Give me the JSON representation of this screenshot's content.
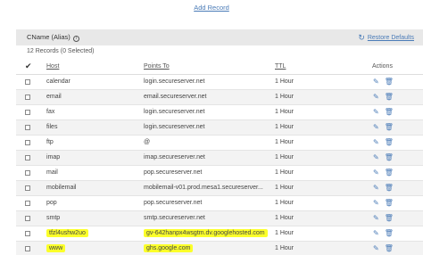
{
  "add_record_label": "Add Record",
  "section": {
    "title": "CName (Alias)",
    "info_glyph": "i",
    "restore_label": "Restore Defaults",
    "restore_glyph": "↻"
  },
  "records_count": "12 Records (0 Selected)",
  "table": {
    "columns": {
      "check": "✔",
      "host": "Host",
      "points_to": "Points To",
      "ttl": "TTL",
      "actions": "Actions"
    },
    "edit_glyph": "✎",
    "delete_glyph": "🗑",
    "rows": [
      {
        "host": "calendar",
        "points_to": "login.secureserver.net",
        "ttl": "1 Hour",
        "highlight": false
      },
      {
        "host": "email",
        "points_to": "email.secureserver.net",
        "ttl": "1 Hour",
        "highlight": false
      },
      {
        "host": "fax",
        "points_to": "login.secureserver.net",
        "ttl": "1 Hour",
        "highlight": false
      },
      {
        "host": "files",
        "points_to": "login.secureserver.net",
        "ttl": "1 Hour",
        "highlight": false
      },
      {
        "host": "ftp",
        "points_to": "@",
        "ttl": "1 Hour",
        "highlight": false
      },
      {
        "host": "imap",
        "points_to": "imap.secureserver.net",
        "ttl": "1 Hour",
        "highlight": false
      },
      {
        "host": "mail",
        "points_to": "pop.secureserver.net",
        "ttl": "1 Hour",
        "highlight": false
      },
      {
        "host": "mobilemail",
        "points_to": "mobilemail-v01.prod.mesa1.secureserver...",
        "ttl": "1 Hour",
        "highlight": false
      },
      {
        "host": "pop",
        "points_to": "pop.secureserver.net",
        "ttl": "1 Hour",
        "highlight": false
      },
      {
        "host": "smtp",
        "points_to": "smtp.secureserver.net",
        "ttl": "1 Hour",
        "highlight": false
      },
      {
        "host": "tfzl4ushw2uo",
        "points_to": "gv-642hanpx4wsgtm.dv.googlehosted.com",
        "ttl": "1 Hour",
        "highlight": true
      },
      {
        "host": "www",
        "points_to": "ghs.google.com",
        "ttl": "1 Hour",
        "highlight": true
      }
    ]
  },
  "colors": {
    "link": "#4a7bb7",
    "highlight": "#fbff2a",
    "header_bg": "#e8e8e8"
  }
}
